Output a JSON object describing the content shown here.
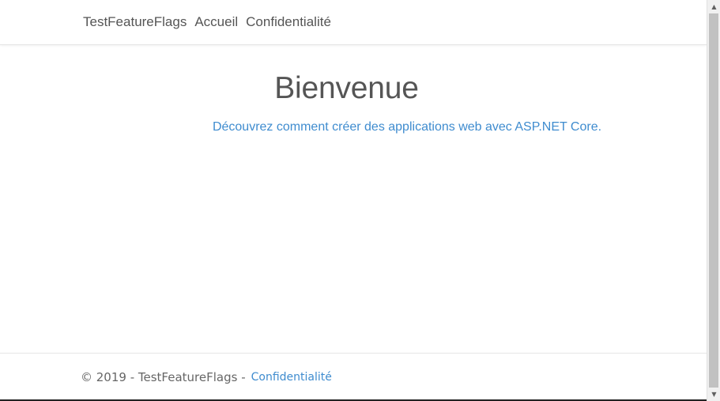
{
  "navbar": {
    "brand": "TestFeatureFlags",
    "links": [
      {
        "label": "Accueil"
      },
      {
        "label": "Confidentialité"
      }
    ]
  },
  "main": {
    "title": "Bienvenue",
    "learn_text": "Découvrez comment créer des applications web avec ASP.NET Core."
  },
  "footer": {
    "copyright": "© 2019 - TestFeatureFlags -",
    "privacy_link": "Confidentialité"
  },
  "colors": {
    "link": "#3f8ccf",
    "text": "#555555"
  },
  "scrollbar": {
    "up_icon": "arrow-up-icon",
    "down_icon": "arrow-down-icon"
  }
}
